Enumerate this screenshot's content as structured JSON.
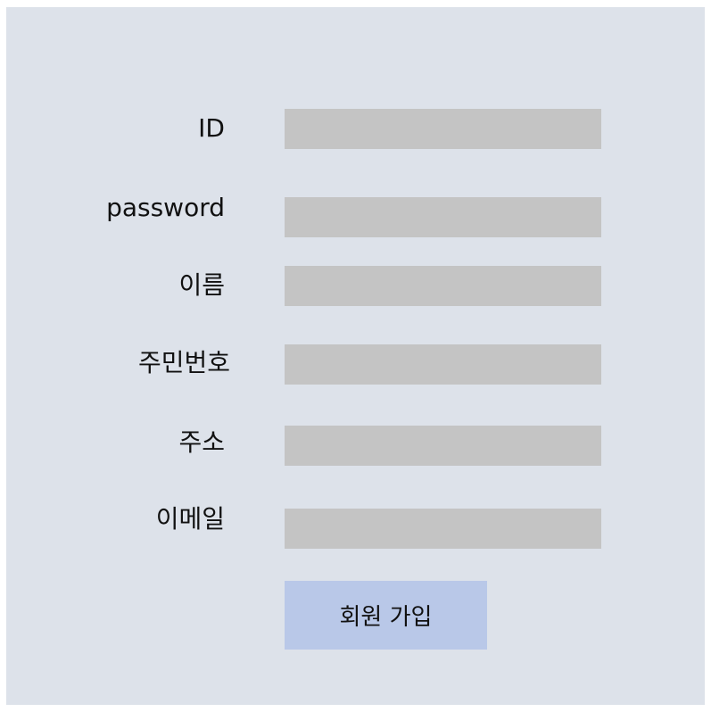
{
  "form": {
    "fields": [
      {
        "label": "ID",
        "value": ""
      },
      {
        "label": "password",
        "value": ""
      },
      {
        "label": "이름",
        "value": ""
      },
      {
        "label": "주민번호",
        "value": ""
      },
      {
        "label": "주소",
        "value": ""
      },
      {
        "label": "이메일",
        "value": ""
      }
    ],
    "submit_label": "회원 가입"
  },
  "colors": {
    "background": "#dde2ea",
    "field": "#c4c4c4",
    "button": "#b9c8e8"
  }
}
